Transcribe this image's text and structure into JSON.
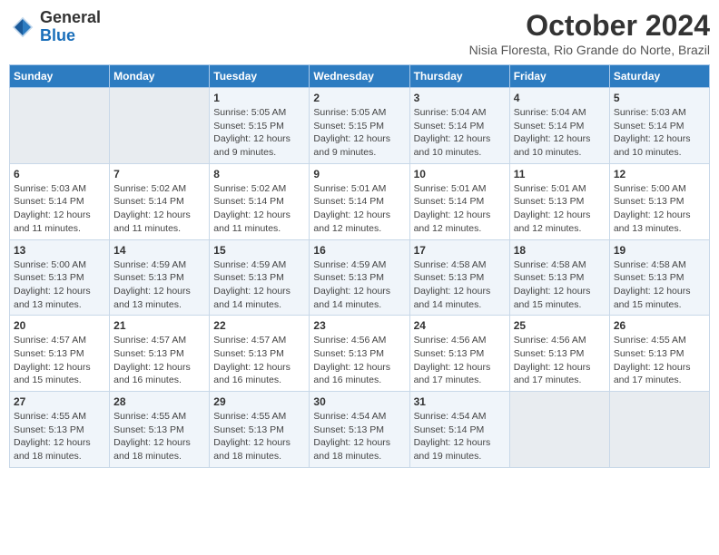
{
  "logo": {
    "text_general": "General",
    "text_blue": "Blue"
  },
  "header": {
    "title": "October 2024",
    "subtitle": "Nisia Floresta, Rio Grande do Norte, Brazil"
  },
  "columns": [
    "Sunday",
    "Monday",
    "Tuesday",
    "Wednesday",
    "Thursday",
    "Friday",
    "Saturday"
  ],
  "weeks": [
    [
      {
        "day": "",
        "empty": true
      },
      {
        "day": "",
        "empty": true
      },
      {
        "day": "1",
        "sunrise": "Sunrise: 5:05 AM",
        "sunset": "Sunset: 5:15 PM",
        "daylight": "Daylight: 12 hours and 9 minutes."
      },
      {
        "day": "2",
        "sunrise": "Sunrise: 5:05 AM",
        "sunset": "Sunset: 5:15 PM",
        "daylight": "Daylight: 12 hours and 9 minutes."
      },
      {
        "day": "3",
        "sunrise": "Sunrise: 5:04 AM",
        "sunset": "Sunset: 5:14 PM",
        "daylight": "Daylight: 12 hours and 10 minutes."
      },
      {
        "day": "4",
        "sunrise": "Sunrise: 5:04 AM",
        "sunset": "Sunset: 5:14 PM",
        "daylight": "Daylight: 12 hours and 10 minutes."
      },
      {
        "day": "5",
        "sunrise": "Sunrise: 5:03 AM",
        "sunset": "Sunset: 5:14 PM",
        "daylight": "Daylight: 12 hours and 10 minutes."
      }
    ],
    [
      {
        "day": "6",
        "sunrise": "Sunrise: 5:03 AM",
        "sunset": "Sunset: 5:14 PM",
        "daylight": "Daylight: 12 hours and 11 minutes."
      },
      {
        "day": "7",
        "sunrise": "Sunrise: 5:02 AM",
        "sunset": "Sunset: 5:14 PM",
        "daylight": "Daylight: 12 hours and 11 minutes."
      },
      {
        "day": "8",
        "sunrise": "Sunrise: 5:02 AM",
        "sunset": "Sunset: 5:14 PM",
        "daylight": "Daylight: 12 hours and 11 minutes."
      },
      {
        "day": "9",
        "sunrise": "Sunrise: 5:01 AM",
        "sunset": "Sunset: 5:14 PM",
        "daylight": "Daylight: 12 hours and 12 minutes."
      },
      {
        "day": "10",
        "sunrise": "Sunrise: 5:01 AM",
        "sunset": "Sunset: 5:14 PM",
        "daylight": "Daylight: 12 hours and 12 minutes."
      },
      {
        "day": "11",
        "sunrise": "Sunrise: 5:01 AM",
        "sunset": "Sunset: 5:13 PM",
        "daylight": "Daylight: 12 hours and 12 minutes."
      },
      {
        "day": "12",
        "sunrise": "Sunrise: 5:00 AM",
        "sunset": "Sunset: 5:13 PM",
        "daylight": "Daylight: 12 hours and 13 minutes."
      }
    ],
    [
      {
        "day": "13",
        "sunrise": "Sunrise: 5:00 AM",
        "sunset": "Sunset: 5:13 PM",
        "daylight": "Daylight: 12 hours and 13 minutes."
      },
      {
        "day": "14",
        "sunrise": "Sunrise: 4:59 AM",
        "sunset": "Sunset: 5:13 PM",
        "daylight": "Daylight: 12 hours and 13 minutes."
      },
      {
        "day": "15",
        "sunrise": "Sunrise: 4:59 AM",
        "sunset": "Sunset: 5:13 PM",
        "daylight": "Daylight: 12 hours and 14 minutes."
      },
      {
        "day": "16",
        "sunrise": "Sunrise: 4:59 AM",
        "sunset": "Sunset: 5:13 PM",
        "daylight": "Daylight: 12 hours and 14 minutes."
      },
      {
        "day": "17",
        "sunrise": "Sunrise: 4:58 AM",
        "sunset": "Sunset: 5:13 PM",
        "daylight": "Daylight: 12 hours and 14 minutes."
      },
      {
        "day": "18",
        "sunrise": "Sunrise: 4:58 AM",
        "sunset": "Sunset: 5:13 PM",
        "daylight": "Daylight: 12 hours and 15 minutes."
      },
      {
        "day": "19",
        "sunrise": "Sunrise: 4:58 AM",
        "sunset": "Sunset: 5:13 PM",
        "daylight": "Daylight: 12 hours and 15 minutes."
      }
    ],
    [
      {
        "day": "20",
        "sunrise": "Sunrise: 4:57 AM",
        "sunset": "Sunset: 5:13 PM",
        "daylight": "Daylight: 12 hours and 15 minutes."
      },
      {
        "day": "21",
        "sunrise": "Sunrise: 4:57 AM",
        "sunset": "Sunset: 5:13 PM",
        "daylight": "Daylight: 12 hours and 16 minutes."
      },
      {
        "day": "22",
        "sunrise": "Sunrise: 4:57 AM",
        "sunset": "Sunset: 5:13 PM",
        "daylight": "Daylight: 12 hours and 16 minutes."
      },
      {
        "day": "23",
        "sunrise": "Sunrise: 4:56 AM",
        "sunset": "Sunset: 5:13 PM",
        "daylight": "Daylight: 12 hours and 16 minutes."
      },
      {
        "day": "24",
        "sunrise": "Sunrise: 4:56 AM",
        "sunset": "Sunset: 5:13 PM",
        "daylight": "Daylight: 12 hours and 17 minutes."
      },
      {
        "day": "25",
        "sunrise": "Sunrise: 4:56 AM",
        "sunset": "Sunset: 5:13 PM",
        "daylight": "Daylight: 12 hours and 17 minutes."
      },
      {
        "day": "26",
        "sunrise": "Sunrise: 4:55 AM",
        "sunset": "Sunset: 5:13 PM",
        "daylight": "Daylight: 12 hours and 17 minutes."
      }
    ],
    [
      {
        "day": "27",
        "sunrise": "Sunrise: 4:55 AM",
        "sunset": "Sunset: 5:13 PM",
        "daylight": "Daylight: 12 hours and 18 minutes."
      },
      {
        "day": "28",
        "sunrise": "Sunrise: 4:55 AM",
        "sunset": "Sunset: 5:13 PM",
        "daylight": "Daylight: 12 hours and 18 minutes."
      },
      {
        "day": "29",
        "sunrise": "Sunrise: 4:55 AM",
        "sunset": "Sunset: 5:13 PM",
        "daylight": "Daylight: 12 hours and 18 minutes."
      },
      {
        "day": "30",
        "sunrise": "Sunrise: 4:54 AM",
        "sunset": "Sunset: 5:13 PM",
        "daylight": "Daylight: 12 hours and 18 minutes."
      },
      {
        "day": "31",
        "sunrise": "Sunrise: 4:54 AM",
        "sunset": "Sunset: 5:14 PM",
        "daylight": "Daylight: 12 hours and 19 minutes."
      },
      {
        "day": "",
        "empty": true
      },
      {
        "day": "",
        "empty": true
      }
    ]
  ]
}
